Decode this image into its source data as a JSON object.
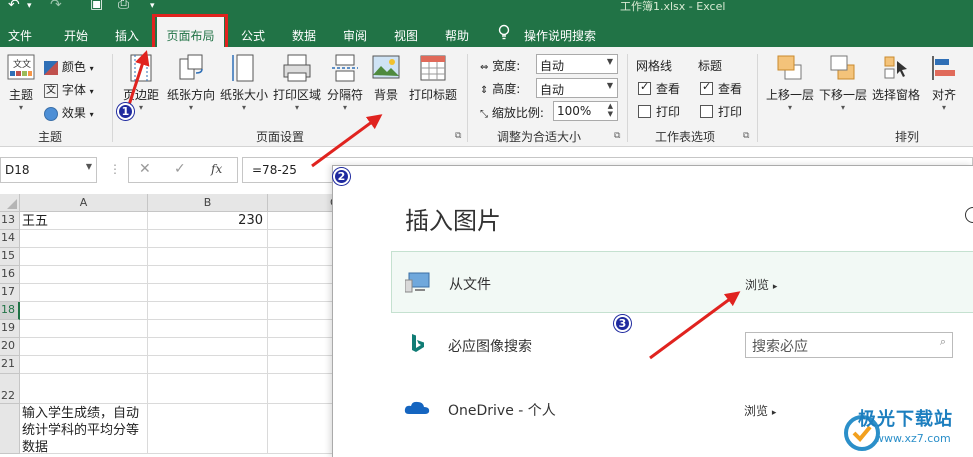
{
  "title_bar": {
    "document_title": "工作簿1.xlsx  -  Excel"
  },
  "tabs": [
    {
      "label": "文件"
    },
    {
      "label": "开始"
    },
    {
      "label": "插入"
    },
    {
      "label": "页面布局",
      "active": true
    },
    {
      "label": "公式"
    },
    {
      "label": "数据"
    },
    {
      "label": "审阅"
    },
    {
      "label": "视图"
    },
    {
      "label": "帮助"
    },
    {
      "label": "操作说明搜索"
    }
  ],
  "ribbon": {
    "theme_group": {
      "label": "主题",
      "theme_button": "主题",
      "colors": "颜色",
      "fonts": "字体",
      "effects": "效果"
    },
    "page_setup_group": {
      "label": "页面设置",
      "margins": "页边距",
      "orientation": "纸张方向",
      "size": "纸张大小",
      "print_area": "打印区域",
      "breaks": "分隔符",
      "background": "背景",
      "print_titles": "打印标题"
    },
    "scale_group": {
      "label": "调整为合适大小",
      "width_label": "宽度:",
      "width_value": "自动",
      "height_label": "高度:",
      "height_value": "自动",
      "scale_label": "缩放比例:",
      "scale_value": "100%"
    },
    "sheet_options_group": {
      "label": "工作表选项",
      "gridlines": "网格线",
      "headings": "标题",
      "view": "查看",
      "print": "打印",
      "gridlines_view_checked": true,
      "gridlines_print_checked": false,
      "headings_view_checked": true,
      "headings_print_checked": false
    },
    "arrange_group": {
      "label": "排列",
      "bring_forward": "上移一层",
      "send_backward": "下移一层",
      "selection_pane": "选择窗格",
      "align": "对齐"
    }
  },
  "formula_bar": {
    "name_box": "D18",
    "formula": "=78-25",
    "fx": "fx"
  },
  "grid": {
    "columns": [
      "A",
      "B",
      "C"
    ],
    "rows": [
      {
        "num": "13",
        "a": "王五",
        "b": "230"
      },
      {
        "num": "14",
        "a": "",
        "b": ""
      },
      {
        "num": "15",
        "a": "",
        "b": ""
      },
      {
        "num": "16",
        "a": "",
        "b": ""
      },
      {
        "num": "17",
        "a": "",
        "b": ""
      },
      {
        "num": "18",
        "a": "",
        "b": ""
      },
      {
        "num": "19",
        "a": "",
        "b": ""
      },
      {
        "num": "20",
        "a": "",
        "b": ""
      },
      {
        "num": "21",
        "a": "",
        "b": ""
      },
      {
        "num": "22",
        "a": "",
        "b": ""
      },
      {
        "num": "",
        "a": "输入学生成绩，自动统计学科的平均分等数据",
        "b": ""
      }
    ]
  },
  "dialog": {
    "title": "插入图片",
    "options": [
      {
        "label": "从文件",
        "action": "浏览"
      },
      {
        "label": "必应图像搜索",
        "search_placeholder": "搜索必应"
      },
      {
        "label": "OneDrive - 个人",
        "action": "浏览"
      }
    ]
  },
  "annotations": {
    "badge_1": "1",
    "badge_2": "2",
    "badge_3": "3"
  },
  "watermark": {
    "name": "极光下载站",
    "url": "www.xz7.com"
  },
  "colors": {
    "excel_green": "#217346",
    "annotation_red": "#e0231f",
    "badge_blue": "#1f2a9f"
  }
}
